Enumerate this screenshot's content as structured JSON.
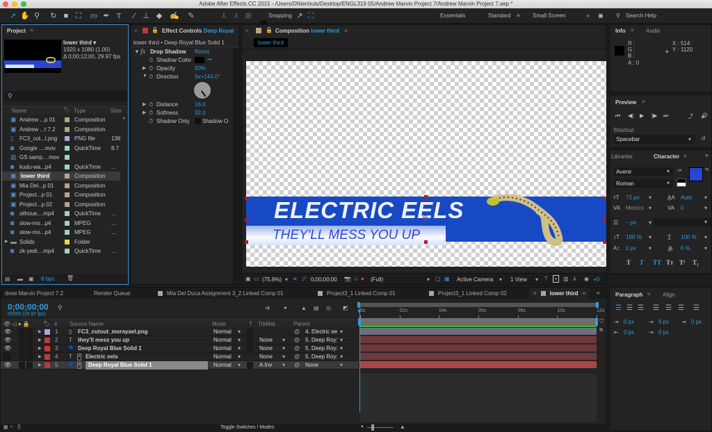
{
  "window": {
    "title": "Adobe After Effects CC 2015 - /Users/DNienhuis/Desktop/ENGL319 05/Andrew Marvin Project 7/Andrew Marvin Project 7.aep *"
  },
  "toolbar": {
    "tools": [
      "selection-tool",
      "hand-tool",
      "zoom-tool",
      "rotation-tool",
      "camera-tool",
      "pan-behind-tool",
      "rectangle-tool",
      "pen-tool",
      "type-tool",
      "brush-tool",
      "clone-stamp-tool",
      "eraser-tool",
      "roto-brush-tool",
      "puppet-pin-tool"
    ],
    "snapping_label": "Snapping",
    "workspaces": [
      "Essentials",
      "Standard",
      "Small Screen"
    ],
    "active_workspace": "Standard",
    "search_help": "Search Help"
  },
  "project": {
    "tab_label": "Project",
    "preview_name": "lower third ▾",
    "preview_res": "1920 x 1080 (1.00)",
    "preview_duration": "Δ 0;00;12;00, 29.97 fps",
    "columns": {
      "name": "Name",
      "type": "Type",
      "size": "Size"
    },
    "items": [
      {
        "name": "Andrew ...p 01",
        "color": "#b5a587",
        "type": "Composition",
        "size": "",
        "icon": "composition-icon"
      },
      {
        "name": "Andrew ...t 7.2",
        "color": "#b5a587",
        "type": "Composition",
        "size": "",
        "icon": "composition-icon"
      },
      {
        "name": "FC3_cut...l.png",
        "color": "#a9a9d6",
        "type": "PNG file",
        "size": "136",
        "icon": "image-file-icon"
      },
      {
        "name": "Google ....mov",
        "color": "#9fd2c9",
        "type": "QuickTime",
        "size": "8.7",
        "icon": "footage-icon"
      },
      {
        "name": "GS samp....mov",
        "color": "#9fd2c9",
        "type": "",
        "size": "",
        "icon": "color-bars-icon"
      },
      {
        "name": "kudu-wa...p4",
        "color": "#9fd2c9",
        "type": "QuickTime",
        "size": "...",
        "icon": "footage-icon"
      },
      {
        "name": "lower third",
        "color": "#b5a587",
        "type": "Composition",
        "size": "",
        "icon": "composition-icon",
        "selected": true
      },
      {
        "name": "Mia Del...p 01",
        "color": "#b5a587",
        "type": "Composition",
        "size": "",
        "icon": "composition-icon"
      },
      {
        "name": "Project...p 01",
        "color": "#b5a587",
        "type": "Composition",
        "size": "",
        "icon": "composition-icon"
      },
      {
        "name": "Project...p 02",
        "color": "#b5a587",
        "type": "Composition",
        "size": "",
        "icon": "composition-icon"
      },
      {
        "name": "silhoue....mp4",
        "color": "#9fd2c9",
        "type": "QuickTime",
        "size": "...",
        "icon": "footage-icon"
      },
      {
        "name": "slow-mo...p4",
        "color": "#9fd2c9",
        "type": "MPEG",
        "size": "...",
        "icon": "footage-icon"
      },
      {
        "name": "slow-mo...p4",
        "color": "#9fd2c9",
        "type": "MPEG",
        "size": "...",
        "icon": "footage-icon"
      },
      {
        "name": "Solids",
        "color": "#e6d84d",
        "type": "Folder",
        "size": "",
        "icon": "folder-icon"
      },
      {
        "name": "zk-yedi....mp4",
        "color": "#9fd2c9",
        "type": "QuickTime",
        "size": "...",
        "icon": "footage-icon"
      }
    ],
    "bpc": "8 bpc"
  },
  "effect_controls": {
    "tab_label": "Effect Controls",
    "tab_layer": "Deep Royal",
    "breadcrumb": "lower third • Deep Royal Blue Solid 1",
    "effect_name": "Drop Shadow",
    "reset": "Reset",
    "props": [
      {
        "label": "Shadow Color",
        "value": "",
        "expandable": false
      },
      {
        "label": "Opacity",
        "value": "50%",
        "expandable": true
      },
      {
        "label": "Direction",
        "value": "0x+144.0°",
        "expandable": true,
        "expanded": true
      },
      {
        "label": "Distance",
        "value": "16.0",
        "expandable": true
      },
      {
        "label": "Softness",
        "value": "32.0",
        "expandable": true
      },
      {
        "label": "Shadow Only",
        "value": "Shadow O",
        "expandable": false
      }
    ],
    "direction_angle_deg": 144
  },
  "composition": {
    "tab_label": "Composition",
    "tab_comp": "lower third",
    "breadcrumb": "lower third",
    "title_text": "ELECTRIC EELS",
    "subtitle_text": "THEY'LL MESS YOU UP",
    "bottom_bar": {
      "zoom": "(75.8%)",
      "timecode": "0;00;00;00",
      "resolution": "(Full)",
      "camera": "Active Camera",
      "views": "1 View"
    }
  },
  "info": {
    "tab_label": "Info",
    "tab_audio": "Audio",
    "r": "R :",
    "g": "G :",
    "b": "B :",
    "a": "A : 0",
    "x": "X : 514",
    "y": "Y : 1120"
  },
  "preview": {
    "tab_label": "Preview",
    "shortcut_label": "Shortcut",
    "shortcut_value": "Spacebar"
  },
  "character": {
    "tab_libraries": "Libraries",
    "tab_label": "Character",
    "font": "Avenir",
    "style": "Roman",
    "fill_color": "#2747d0",
    "size": "72 px",
    "leading": "Auto",
    "kerning": "Metrics",
    "tracking": "0",
    "stroke_width": "– px",
    "vscale": "100 %",
    "hscale": "100 %",
    "baseline": "0 px",
    "tsume": "0 %",
    "styles": [
      "T",
      "T",
      "TT",
      "Tт",
      "T¹",
      "T₁"
    ]
  },
  "paragraph": {
    "tab_label": "Paragraph",
    "tab_align": "Align",
    "indent_left": "0 px",
    "space_before": "0 px",
    "indent_first": "0 px",
    "indent_right": "0 px",
    "space_after": "0 px"
  },
  "timeline": {
    "tabs": [
      "drew Marvin Project 7.2",
      "Render Queue",
      "Mia Del Duca Assignment 3_2 Linked Comp 01",
      "Project3_1 Linked Comp 01",
      "Project3_1 Linked Comp 02",
      "lower third"
    ],
    "active_tab": "lower third",
    "timecode": "0;00;00;00",
    "frames": "00000 (29.97 fps)",
    "columns": {
      "num": "#",
      "source": "Source Name",
      "mode": "Mode",
      "t": "T",
      "trkmat": "TrkMat",
      "parent": "Parent"
    },
    "ruler": [
      "0s",
      "02s",
      "04s",
      "06s",
      "08s",
      "10s",
      "12s"
    ],
    "layers": [
      {
        "num": "1",
        "label_color": "#a9a9d6",
        "name": "FC3_cutout_morayael.png",
        "mode": "Normal",
        "trkmat": "",
        "parent": "4. Electric ee",
        "bar_color": "#6e6e80",
        "visible": true,
        "icon": "image-file-icon"
      },
      {
        "num": "2",
        "label_color": "#c0393b",
        "name": "they'll mess you up",
        "mode": "Normal",
        "trkmat": "None",
        "parent": "5. Deep Roy:",
        "bar_color": "#6e3939",
        "visible": true,
        "icon": "text-layer-icon"
      },
      {
        "num": "3",
        "label_color": "#c0393b",
        "name": "Deep Royal Blue Solid 1",
        "mode": "Normal",
        "trkmat": "None",
        "parent": "5. Deep Roy:",
        "bar_color": "#6e3939",
        "visible": true,
        "icon": "solid-icon"
      },
      {
        "num": "4",
        "label_color": "#c0393b",
        "name": "Electric eels",
        "mode": "Normal",
        "trkmat": "None",
        "parent": "5. Deep Roy:",
        "bar_color": "#6e3939",
        "visible": false,
        "icon": "text-layer-icon"
      },
      {
        "num": "5",
        "label_color": "#c0393b",
        "name": "Deep Royal Blue Solid 1",
        "mode": "Normal",
        "trkmat": "A.Inv",
        "parent": "None",
        "bar_color": "#a94747",
        "visible": true,
        "icon": "solid-icon",
        "selected": true
      }
    ],
    "toggle_label": "Toggle Switches / Modes"
  }
}
